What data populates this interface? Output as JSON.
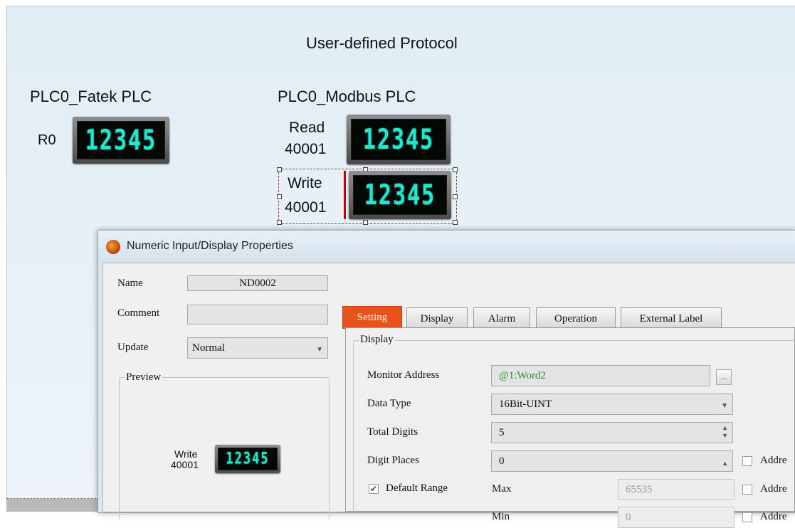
{
  "canvas": {
    "title": "User-defined Protocol",
    "fatek": {
      "header": "PLC0_Fatek PLC",
      "reg_label": "R0",
      "value": "12345"
    },
    "modbus": {
      "header": "PLC0_Modbus PLC",
      "read_label_1": "Read",
      "read_label_2": "40001",
      "read_value": "12345",
      "write_label_1": "Write",
      "write_label_2": "40001",
      "write_value": "12345"
    }
  },
  "dialog": {
    "title": "Numeric Input/Display Properties",
    "name_label": "Name",
    "name_value": "ND0002",
    "comment_label": "Comment",
    "comment_value": "",
    "update_label": "Update",
    "update_value": "Normal",
    "preview": {
      "label": "Preview",
      "line1": "Write",
      "line2": "40001",
      "value": "12345"
    },
    "tabs": [
      "Setting",
      "Display",
      "Alarm",
      "Operation",
      "External Label"
    ],
    "active_tab": "Setting",
    "display_group": "Display",
    "monitor_address_label": "Monitor Address",
    "monitor_address_value": "@1:Word2",
    "browse_button": "...",
    "data_type_label": "Data Type",
    "data_type_value": "16Bit-UINT",
    "total_digits_label": "Total Digits",
    "total_digits_value": "5",
    "digit_places_label": "Digit Places",
    "digit_places_value": "0",
    "default_range_label": "Default Range",
    "default_range_checked": true,
    "max_label": "Max",
    "max_value": "65535",
    "min_label": "Min",
    "min_value": "0",
    "address_label": "Addre"
  },
  "colors": {
    "active_tab": "#e8531c",
    "lcd_digits": "#25e6c8",
    "monitor_address_text": "#2a8a2a"
  }
}
